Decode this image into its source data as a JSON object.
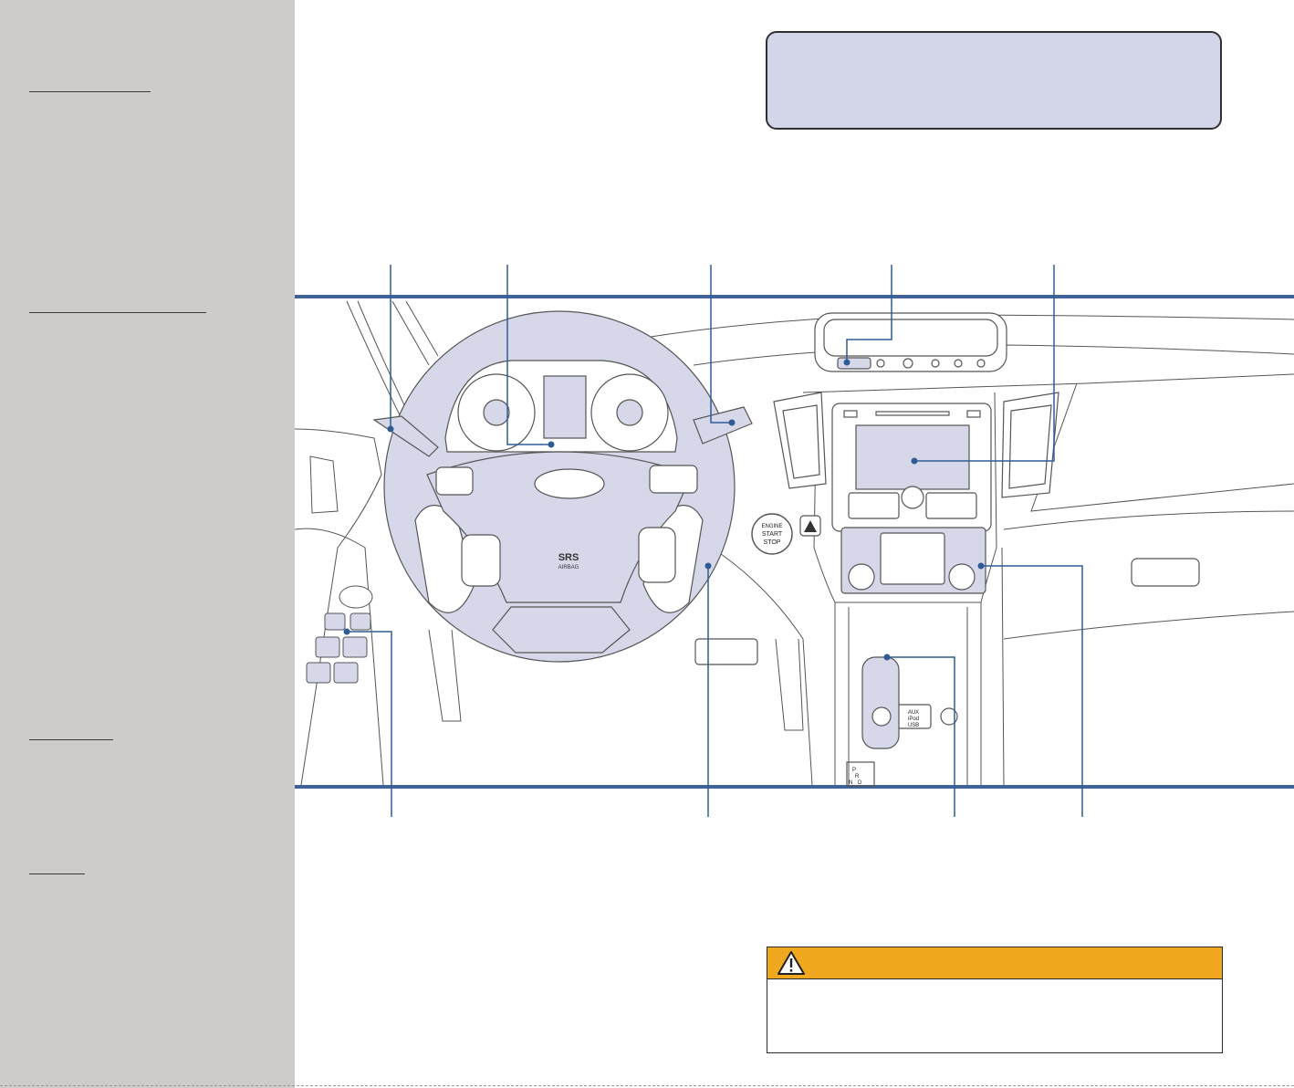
{
  "steering_wheel": {
    "badge": "SRS",
    "sub": "AIRBAG"
  },
  "start_button": {
    "line1": "ENGINE",
    "line2": "START",
    "line3": "STOP"
  },
  "aux_port": {
    "line1": "AUX",
    "line2": "iPod",
    "line3": "USB"
  },
  "shifter_gates": [
    "P",
    "R",
    "N",
    "D"
  ],
  "icons": {
    "warning": "warning-triangle-icon",
    "hazard": "hazard-triangle-icon"
  },
  "colors": {
    "sidebar": "#cdcccb",
    "rule": "#3f6399",
    "callout": "#2f5c95",
    "highlight": "#d6d8ea",
    "info_box": "#d3d6e8",
    "warning": "#f0a81e"
  }
}
